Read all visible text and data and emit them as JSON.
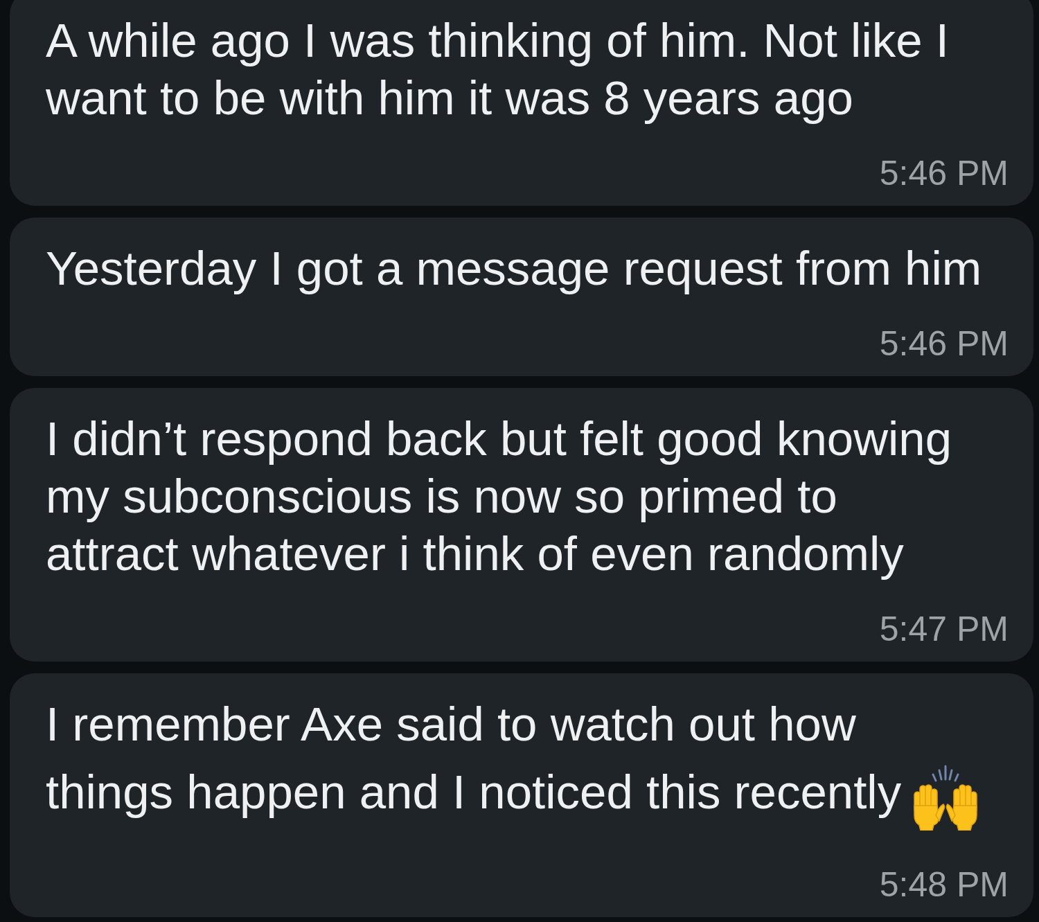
{
  "messages": [
    {
      "text": "A while ago I was thinking of him. Not like I\nwant to be with him it was 8 years ago",
      "time": "5:46 PM",
      "trailing_emoji": false
    },
    {
      "text": "Yesterday I got a message request from him",
      "time": "5:46 PM",
      "trailing_emoji": false
    },
    {
      "text": "I didn’t respond back but felt good knowing\nmy subconscious is now so primed to\nattract whatever i think of even randomly",
      "time": "5:47 PM",
      "trailing_emoji": false
    },
    {
      "text": "I remember Axe said to watch out how\nthings happen and I noticed this recently",
      "time": "5:48 PM",
      "trailing_emoji": true
    }
  ]
}
